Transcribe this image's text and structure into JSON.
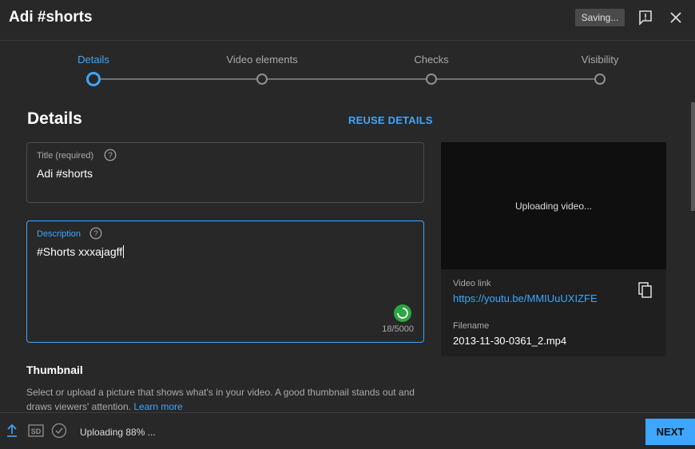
{
  "header": {
    "title": "Adi #shorts",
    "saving_badge": "Saving...",
    "feedback_icon": "feedback-icon",
    "close_icon": "close-icon"
  },
  "stepper": {
    "steps": [
      {
        "label": "Details",
        "active": true
      },
      {
        "label": "Video elements",
        "active": false
      },
      {
        "label": "Checks",
        "active": false
      },
      {
        "label": "Visibility",
        "active": false
      }
    ]
  },
  "details": {
    "section_title": "Details",
    "reuse_label": "REUSE DETAILS",
    "title_field": {
      "label": "Title (required)",
      "value": "Adi #shorts"
    },
    "description_field": {
      "label": "Description",
      "value": "#Shorts xxxajagff",
      "counter": "18/5000"
    },
    "thumbnail": {
      "title": "Thumbnail",
      "description": "Select or upload a picture that shows what's in your video. A good thumbnail stands out and draws viewers' attention.",
      "learn_more": "Learn more"
    }
  },
  "preview": {
    "status": "Uploading video...",
    "video_link_label": "Video link",
    "video_link": "https://youtu.be/MMIUuUXIZFE",
    "filename_label": "Filename",
    "filename": "2013-11-30-0361_2.mp4"
  },
  "footer": {
    "upload_status": "Uploading 88% ...",
    "sd_badge": "SD",
    "next_label": "NEXT"
  },
  "colors": {
    "background": "#282828",
    "accent": "#3ea6ff",
    "spinner": "#2ba640"
  }
}
